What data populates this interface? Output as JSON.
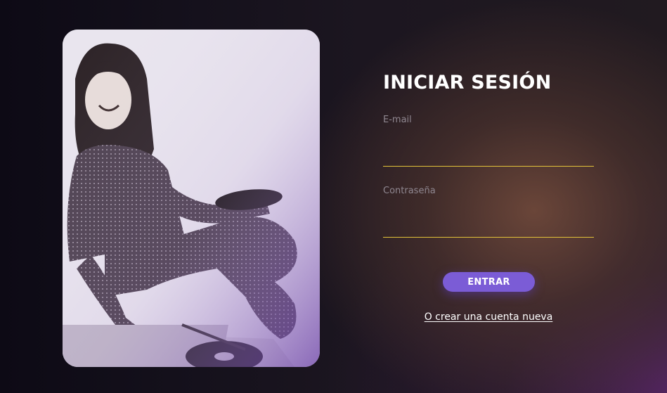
{
  "photo": {
    "icon": "vintage-photo-woman-with-record-player"
  },
  "login": {
    "title": "INICIAR SESIÓN",
    "email_label": "E-mail",
    "email_value": "",
    "password_label": "Contraseña",
    "password_value": "",
    "submit_label": "ENTRAR",
    "register_link": "O crear una cuenta nueva"
  },
  "colors": {
    "accent_button": "#7b5cd6",
    "input_underline": "#e2c23a",
    "title": "#ffffff",
    "label": "#8f8790"
  }
}
